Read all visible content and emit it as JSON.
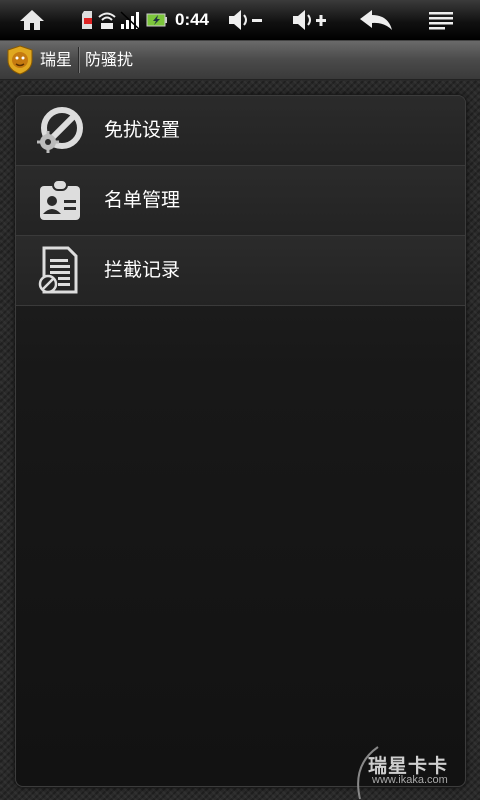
{
  "status_bar": {
    "time": "0:44",
    "icons": [
      "home-icon",
      "sd-card-icon",
      "wifi-icon",
      "signal-icon",
      "battery-icon",
      "volume-down-icon",
      "volume-up-icon",
      "back-icon",
      "menu-icon"
    ]
  },
  "title_bar": {
    "app_name": "瑞星",
    "page_title": "防骚扰"
  },
  "menu": {
    "items": [
      {
        "label": "免扰设置",
        "icon": "settings-block-icon"
      },
      {
        "label": "名单管理",
        "icon": "contact-card-icon"
      },
      {
        "label": "拦截记录",
        "icon": "blocked-log-icon"
      }
    ]
  },
  "watermark": {
    "brand": "瑞星卡卡",
    "url": "www.ikaka.com"
  },
  "colors": {
    "background": "#2a2a2a",
    "panel": "#1a1a1a",
    "text": "#ffffff",
    "battery": "#7cc63b"
  }
}
